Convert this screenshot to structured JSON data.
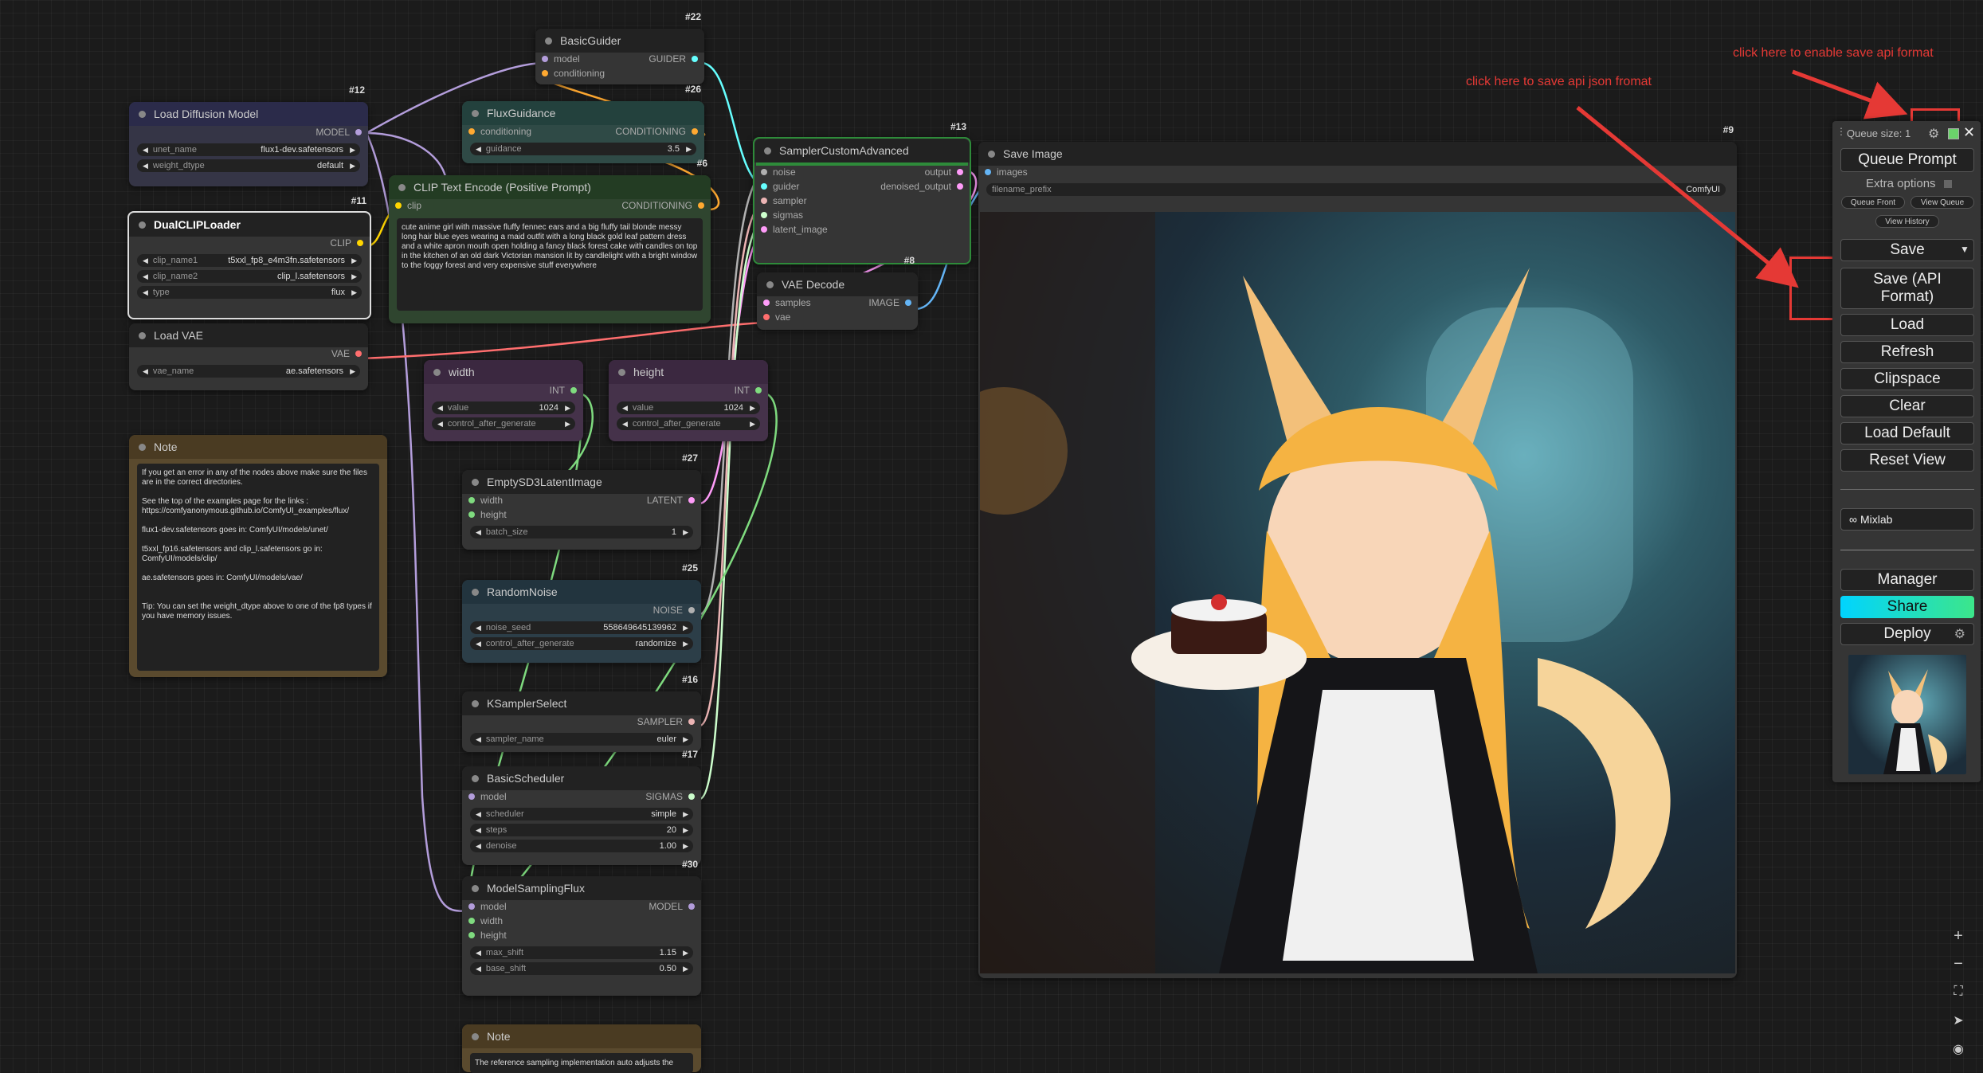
{
  "nodes": {
    "load_diffusion": {
      "id": "#12",
      "title": "Load Diffusion Model",
      "out": "MODEL",
      "unet_name_label": "unet_name",
      "unet_name": "flux1-dev.safetensors",
      "weight_dtype_label": "weight_dtype",
      "weight_dtype": "default"
    },
    "dual_clip": {
      "id": "#11",
      "title": "DualCLIPLoader",
      "out": "CLIP",
      "clip_name1_label": "clip_name1",
      "clip_name1": "t5xxl_fp8_e4m3fn.safetensors",
      "clip_name2_label": "clip_name2",
      "clip_name2": "clip_l.safetensors",
      "type_label": "type",
      "type": "flux"
    },
    "load_vae": {
      "title": "Load VAE",
      "out": "VAE",
      "vae_name_label": "vae_name",
      "vae_name": "ae.safetensors"
    },
    "note1": {
      "title": "Note",
      "text": "If you get an error in any of the nodes above make sure the files are in the correct directories.\n\nSee the top of the examples page for the links : https://comfyanonymous.github.io/ComfyUI_examples/flux/\n\nflux1-dev.safetensors goes in: ComfyUI/models/unet/\n\nt5xxl_fp16.safetensors and clip_l.safetensors go in: ComfyUI/models/clip/\n\nae.safetensors goes in: ComfyUI/models/vae/\n\n\nTip: You can set the weight_dtype above to one of the fp8 types if you have memory issues."
    },
    "basic_guider": {
      "id": "#22",
      "title": "BasicGuider",
      "in1": "model",
      "in2": "conditioning",
      "out": "GUIDER"
    },
    "flux_guidance": {
      "id": "#26",
      "title": "FluxGuidance",
      "in1": "conditioning",
      "out": "CONDITIONING",
      "guidance_label": "guidance",
      "guidance": "3.5"
    },
    "clip_text": {
      "id": "#6",
      "title": "CLIP Text Encode (Positive Prompt)",
      "in1": "clip",
      "out": "CONDITIONING",
      "text": "cute anime girl with massive fluffy fennec ears and a big fluffy tail blonde messy long hair blue eyes wearing a maid outfit with a long black gold leaf pattern dress and a white apron mouth open holding a fancy black forest cake with candles on top in the kitchen of an old dark Victorian mansion lit by candlelight with a bright window to the foggy forest and very expensive stuff everywhere"
    },
    "width": {
      "title": "width",
      "out": "INT",
      "value_label": "value",
      "value": "1024",
      "control_label": "control_after_generate",
      "control": ""
    },
    "height": {
      "title": "height",
      "out": "INT",
      "value_label": "value",
      "value": "1024",
      "control_label": "control_after_generate",
      "control": ""
    },
    "sampler_custom": {
      "id": "#13",
      "title": "SamplerCustomAdvanced",
      "in1": "noise",
      "in2": "guider",
      "in3": "sampler",
      "in4": "sigmas",
      "in5": "latent_image",
      "out1": "output",
      "out2": "denoised_output"
    },
    "vae_decode": {
      "id": "#8",
      "title": "VAE Decode",
      "in1": "samples",
      "in2": "vae",
      "out": "IMAGE"
    },
    "empty_latent": {
      "id": "#27",
      "title": "EmptySD3LatentImage",
      "in1": "width",
      "in2": "height",
      "out": "LATENT",
      "batch_label": "batch_size",
      "batch": "1"
    },
    "random_noise": {
      "id": "#25",
      "title": "RandomNoise",
      "out": "NOISE",
      "seed_label": "noise_seed",
      "seed": "558649645139962",
      "control_label": "control_after_generate",
      "control": "randomize"
    },
    "ksampler_select": {
      "id": "#16",
      "title": "KSamplerSelect",
      "out": "SAMPLER",
      "sampler_label": "sampler_name",
      "sampler": "euler"
    },
    "basic_scheduler": {
      "id": "#17",
      "title": "BasicScheduler",
      "in1": "model",
      "out": "SIGMAS",
      "scheduler_label": "scheduler",
      "scheduler": "simple",
      "steps_label": "steps",
      "steps": "20",
      "denoise_label": "denoise",
      "denoise": "1.00"
    },
    "model_sampling": {
      "id": "#30",
      "title": "ModelSamplingFlux",
      "in1": "model",
      "in2": "width",
      "in3": "height",
      "out": "MODEL",
      "max_shift_label": "max_shift",
      "max_shift": "1.15",
      "base_shift_label": "base_shift",
      "base_shift": "0.50"
    },
    "note2": {
      "title": "Note",
      "text": "The reference sampling implementation auto adjusts the"
    },
    "save_image": {
      "id": "#9",
      "title": "Save Image",
      "in1": "images",
      "prefix_label": "filename_prefix",
      "prefix": "ComfyUI"
    }
  },
  "panel": {
    "queue_size": "Queue size: 1",
    "queue_prompt": "Queue Prompt",
    "extra_options": "Extra options",
    "queue_front": "Queue Front",
    "view_queue": "View Queue",
    "view_history": "View History",
    "save": "Save",
    "save_api": "Save (API Format)",
    "load": "Load",
    "refresh": "Refresh",
    "clipspace": "Clipspace",
    "clear": "Clear",
    "load_default": "Load Default",
    "reset_view": "Reset View",
    "mixlab": "Mixlab",
    "manager": "Manager",
    "share": "Share",
    "deploy": "Deploy"
  },
  "annotations": {
    "enable_api": "click here to enable save api format",
    "save_api_json": "click here to save api json fromat"
  },
  "colors": {
    "model": "#b39ddb",
    "clip": "#ffd500",
    "vae": "#ff6e6e",
    "conditioning": "#ffa931",
    "latent": "#ff9cf9",
    "image": "#64b5f6",
    "int": "#7fdb7f",
    "noise": "#b0b0b0",
    "guider": "#66ffff",
    "sampler": "#ecb4b4",
    "sigmas": "#cdffcd",
    "accent": "#e53935"
  }
}
